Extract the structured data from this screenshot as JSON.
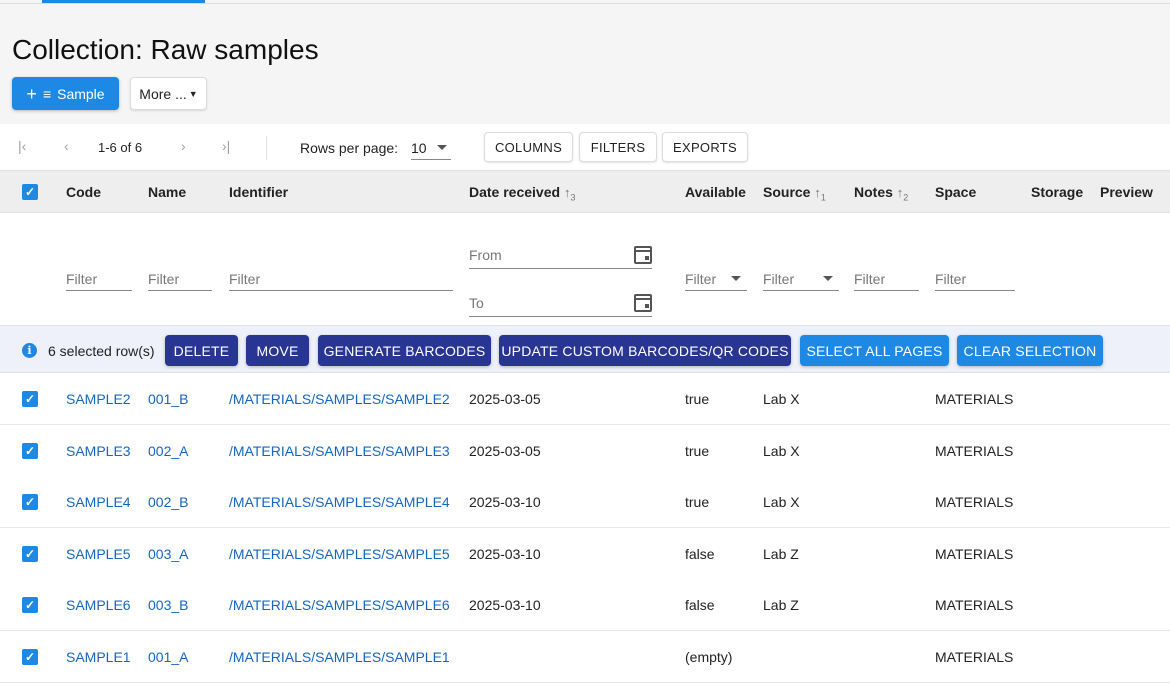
{
  "page": {
    "title": "Collection: Raw samples"
  },
  "actions": {
    "add_sample_label": "Sample",
    "more_label": "More ..."
  },
  "pager": {
    "range_text": "1-6 of 6",
    "rows_per_page_label": "Rows per page:",
    "rows_per_page_value": "10"
  },
  "toolbar": {
    "columns_label": "COLUMNS",
    "filters_label": "FILTERS",
    "exports_label": "EXPORTS"
  },
  "columns": {
    "code": "Code",
    "name": "Name",
    "identifier": "Identifier",
    "date_received": "Date received",
    "date_received_sort": "3",
    "available": "Available",
    "source": "Source",
    "source_sort": "1",
    "notes": "Notes",
    "notes_sort": "2",
    "space": "Space",
    "storage": "Storage",
    "preview": "Preview"
  },
  "filters": {
    "placeholder": "Filter",
    "from": "From",
    "to": "To"
  },
  "selection": {
    "text": "6 selected row(s)",
    "delete": "DELETE",
    "move": "MOVE",
    "generate_barcodes": "GENERATE BARCODES",
    "update_custom": "UPDATE CUSTOM BARCODES/QR CODES",
    "select_all_pages": "SELECT ALL PAGES",
    "clear_selection": "CLEAR SELECTION"
  },
  "rows": [
    {
      "code": "SAMPLE2",
      "name": "001_B",
      "identifier": "/MATERIALS/SAMPLES/SAMPLE2",
      "date": "2025-03-05",
      "available": "true",
      "source": "Lab X",
      "space": "MATERIALS"
    },
    {
      "code": "SAMPLE3",
      "name": "002_A",
      "identifier": "/MATERIALS/SAMPLES/SAMPLE3",
      "date": "2025-03-05",
      "available": "true",
      "source": "Lab X",
      "space": "MATERIALS"
    },
    {
      "code": "SAMPLE4",
      "name": "002_B",
      "identifier": "/MATERIALS/SAMPLES/SAMPLE4",
      "date": "2025-03-10",
      "available": "true",
      "source": "Lab X",
      "space": "MATERIALS"
    },
    {
      "code": "SAMPLE5",
      "name": "003_A",
      "identifier": "/MATERIALS/SAMPLES/SAMPLE5",
      "date": "2025-03-10",
      "available": "false",
      "source": "Lab Z",
      "space": "MATERIALS"
    },
    {
      "code": "SAMPLE6",
      "name": "003_B",
      "identifier": "/MATERIALS/SAMPLES/SAMPLE6",
      "date": "2025-03-10",
      "available": "false",
      "source": "Lab Z",
      "space": "MATERIALS"
    },
    {
      "code": "SAMPLE1",
      "name": "001_A",
      "identifier": "/MATERIALS/SAMPLES/SAMPLE1",
      "date": "",
      "available": "(empty)",
      "source": "",
      "space": "MATERIALS"
    }
  ],
  "colors": {
    "primary": "#1e88e5",
    "dark_action": "#283593",
    "link": "#1565c0"
  }
}
